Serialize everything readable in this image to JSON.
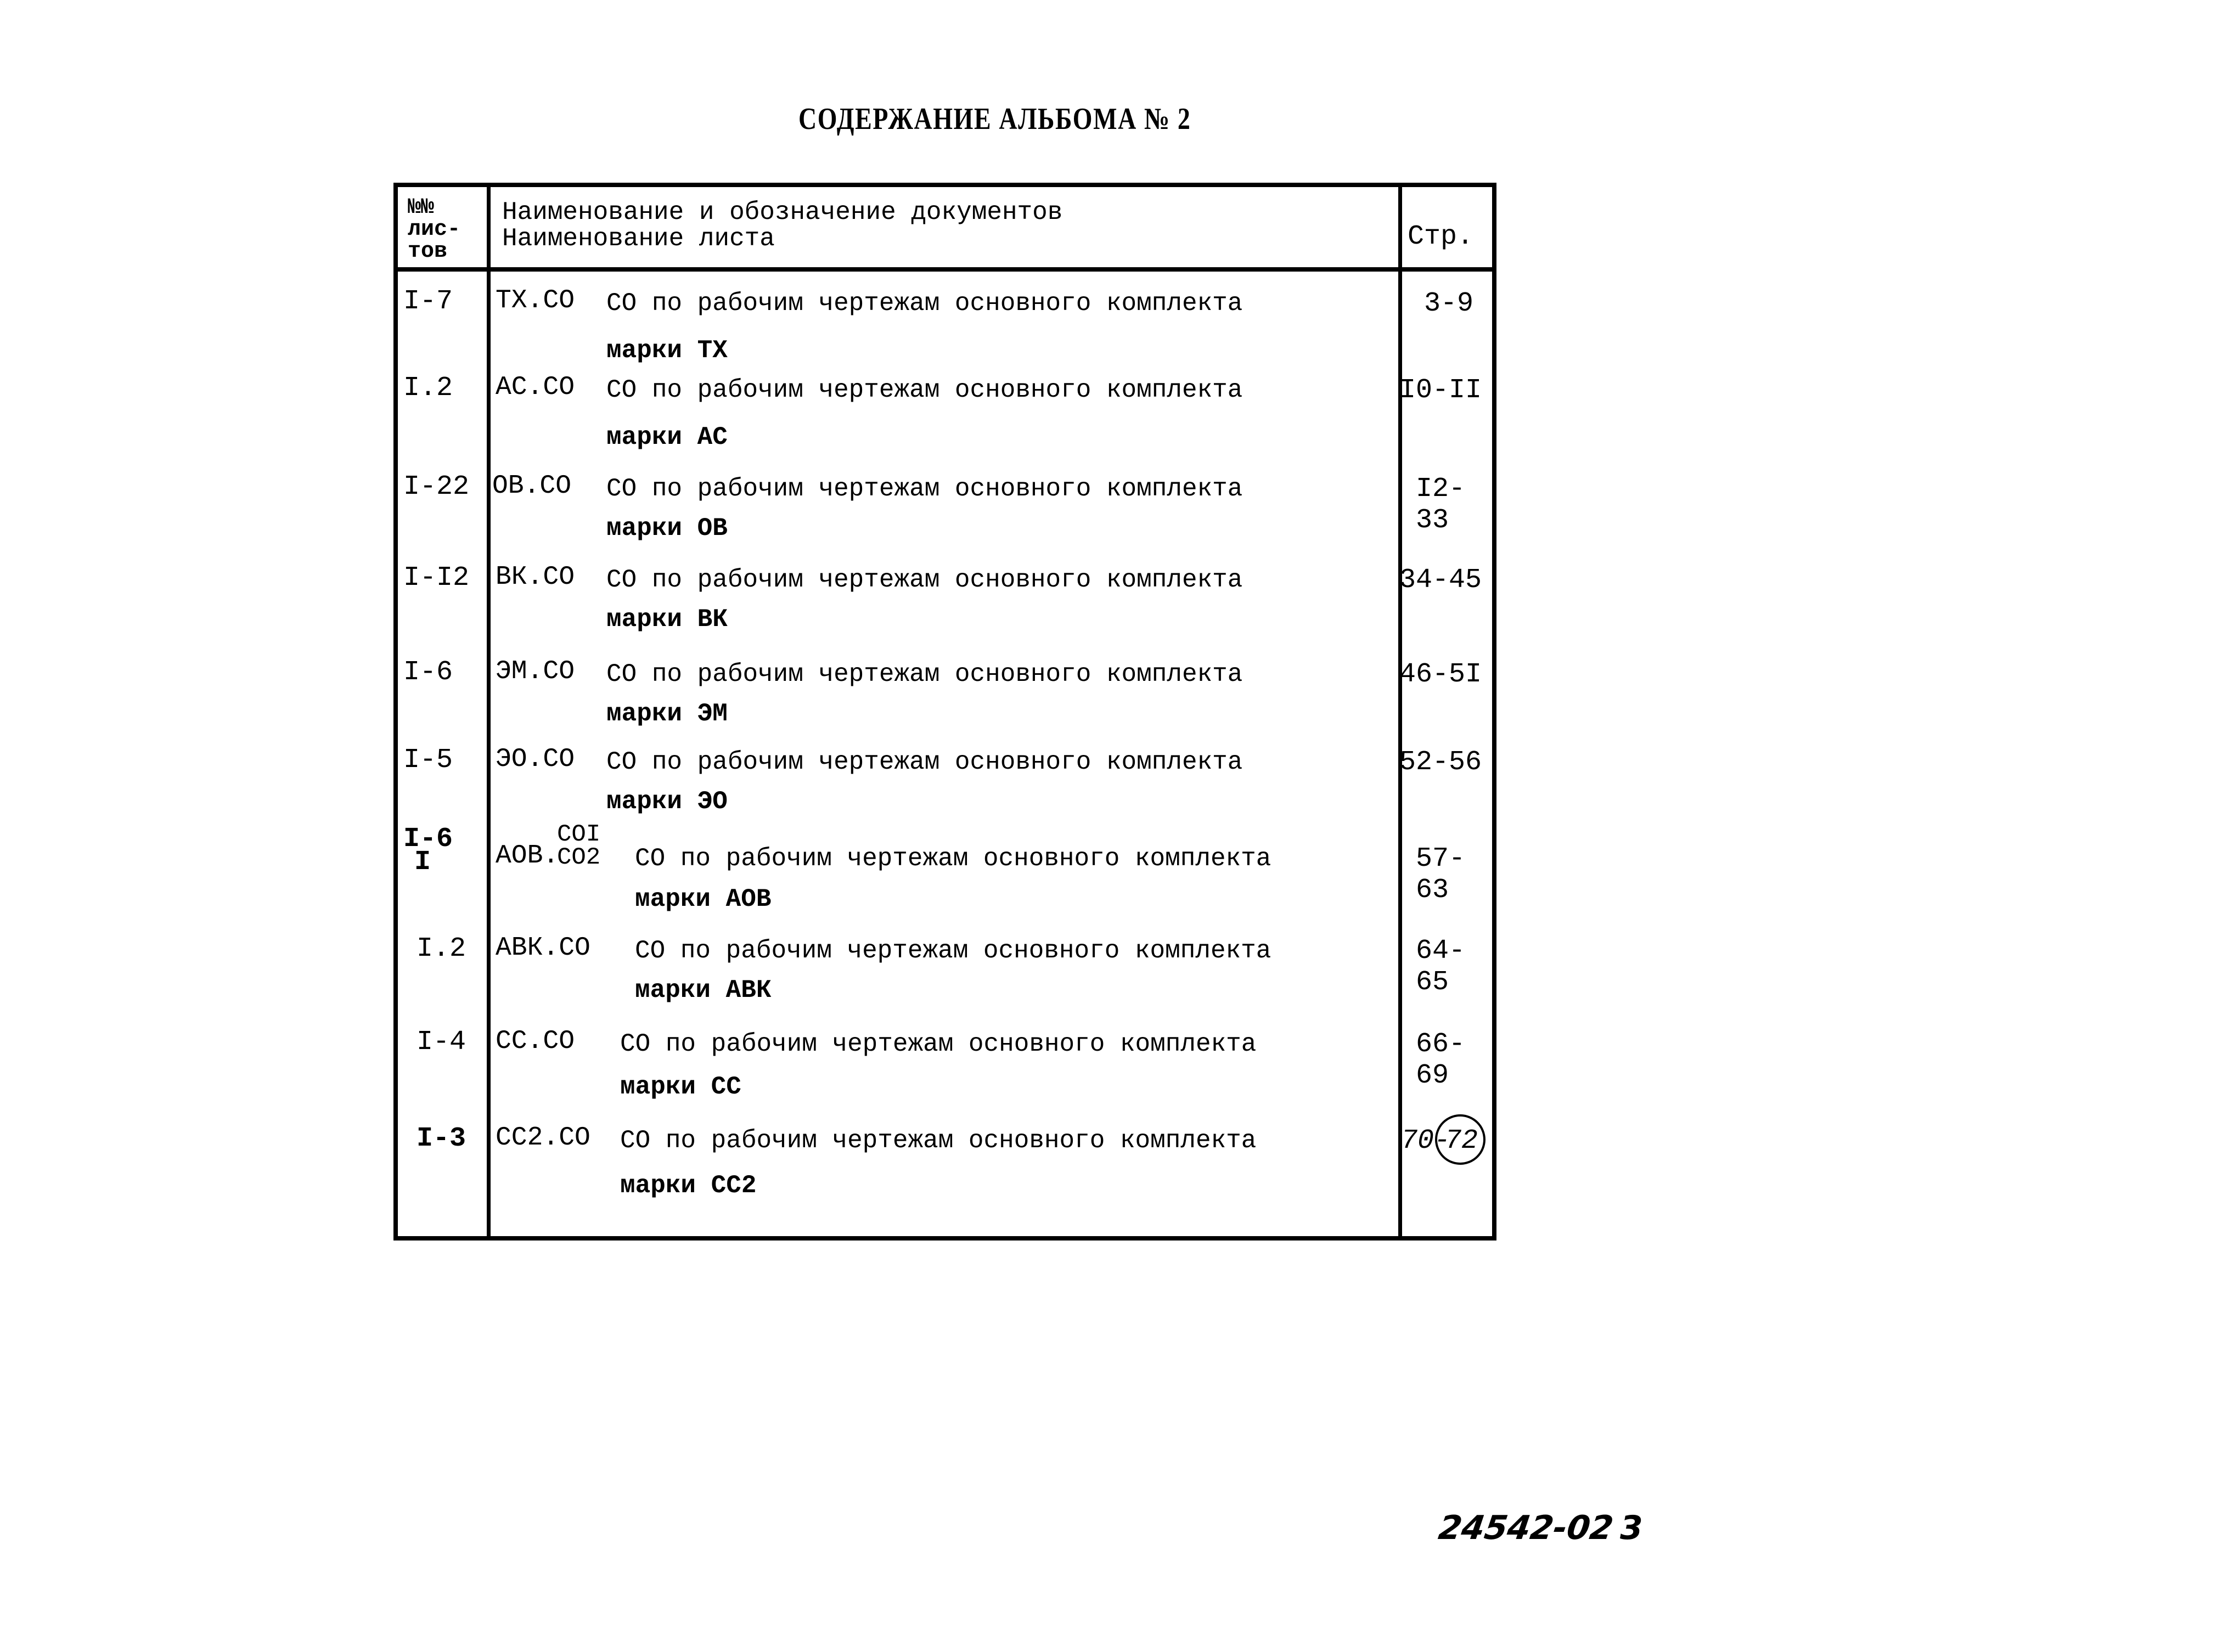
{
  "title": "СОДЕРЖАНИЕ АЛЬБОМА № 2",
  "table": {
    "headers": {
      "sheet_numbers": [
        "№№",
        "лис-",
        "тов"
      ],
      "name_line1": "Наименование и обозначение документов",
      "name_line2": "Наименование листа",
      "page": "Стр."
    },
    "rows": [
      {
        "sheets": "I-7",
        "code": "ТХ.СО",
        "desc": "СО по рабочим чертежам основного комплекта",
        "mark": "марки ТХ",
        "pages": "3-9"
      },
      {
        "sheets": "I.2",
        "code": "АС.СО",
        "desc": "СО по рабочим чертежам основного комплекта",
        "mark": "марки АС",
        "pages": "I0-II"
      },
      {
        "sheets": "I-22",
        "code": "ОВ.СО",
        "desc": "СО по рабочим чертежам основного комплекта",
        "mark": "марки ОВ",
        "pages": "I2-33"
      },
      {
        "sheets": "I-I2",
        "code": "ВК.СО",
        "desc": "СО по рабочим чертежам основного комплекта",
        "mark": "марки ВК",
        "pages": "34-45"
      },
      {
        "sheets": "I-6",
        "code": "ЭМ.СО",
        "desc": "СО по рабочим чертежам основного комплекта",
        "mark": "марки ЭМ",
        "pages": "46-5I"
      },
      {
        "sheets": "I-5",
        "code": "ЭО.СО",
        "desc": "СО по рабочим чертежам основного комплекта",
        "mark": "марки ЭО",
        "pages": "52-56"
      },
      {
        "sheets": "I-6",
        "sheets_sub": "I",
        "code": "АОВ.",
        "code_sup": "СОI",
        "code_sub": "СО2",
        "desc": "СО по рабочим чертежам основного комплекта",
        "mark": "марки АОВ",
        "pages": "57-63"
      },
      {
        "sheets": "I.2",
        "code": "АВК.СО",
        "desc": "СО по рабочим чертежам основного комплекта",
        "mark": "марки АВК",
        "pages": "64-65"
      },
      {
        "sheets": "I-4",
        "code": "СС.СО",
        "desc": "СО по рабочим чертежам основного комплекта",
        "mark": "марки СС",
        "pages": "66-69"
      },
      {
        "sheets": "I-3",
        "code": "СС2.СО",
        "desc": "СО по рабочим чертежам основного комплекта",
        "mark": "марки СС2",
        "pages_start": "70-",
        "pages_circled": "72"
      }
    ]
  },
  "footer": {
    "doc_code": "24542-02",
    "page_number": "3"
  }
}
